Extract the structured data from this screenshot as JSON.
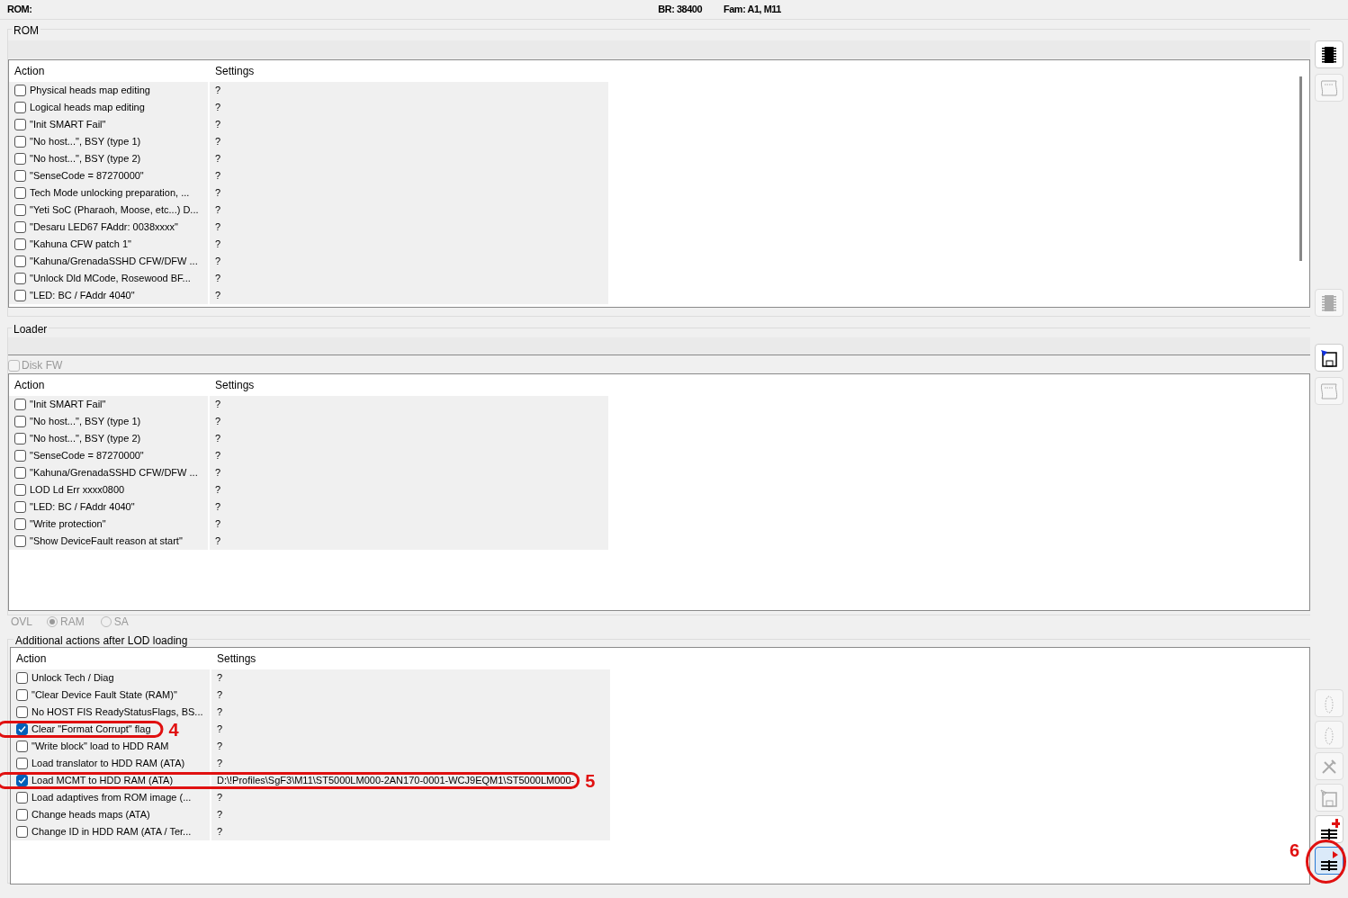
{
  "status_bar": {
    "left": "ROM:",
    "baud": "BR: 38400",
    "family": "Fam: A1, M11"
  },
  "rom": {
    "title": "ROM",
    "columns": [
      "Action",
      "Settings"
    ],
    "rows": [
      {
        "action": "Physical heads map editing",
        "settings": "?",
        "checked": false
      },
      {
        "action": "Logical heads map editing",
        "settings": "?",
        "checked": false
      },
      {
        "action": "\"Init SMART Fail\"",
        "settings": "?",
        "checked": false
      },
      {
        "action": "\"No host...\", BSY (type 1)",
        "settings": "?",
        "checked": false
      },
      {
        "action": "\"No host...\", BSY (type 2)",
        "settings": "?",
        "checked": false
      },
      {
        "action": "\"SenseCode = 87270000\"",
        "settings": "?",
        "checked": false
      },
      {
        "action": "Tech Mode unlocking preparation, ...",
        "settings": "?",
        "checked": false
      },
      {
        "action": "\"Yeti SoC (Pharaoh, Moose, etc...) D...",
        "settings": "?",
        "checked": false
      },
      {
        "action": "\"Desaru LED67 FAddr: 0038xxxx\"",
        "settings": "?",
        "checked": false
      },
      {
        "action": "\"Kahuna CFW patch 1\"",
        "settings": "?",
        "checked": false
      },
      {
        "action": "\"Kahuna/GrenadaSSHD CFW/DFW ...",
        "settings": "?",
        "checked": false
      },
      {
        "action": "\"Unlock Dld MCode, Rosewood BF...",
        "settings": "?",
        "checked": false
      },
      {
        "action": "\"LED: BC / FAddr 4040\"",
        "settings": "?",
        "checked": false
      }
    ],
    "tools": [
      {
        "kind": "chip",
        "disabled": false
      },
      {
        "kind": "tape",
        "disabled": true
      }
    ],
    "bottom_tools": [
      {
        "kind": "chip",
        "disabled": true
      }
    ]
  },
  "loader": {
    "title": "Loader",
    "disk_fw": {
      "label": "Disk FW",
      "checked": false,
      "disabled": true
    },
    "columns": [
      "Action",
      "Settings"
    ],
    "rows": [
      {
        "action": "\"Init SMART Fail\"",
        "settings": "?",
        "checked": false
      },
      {
        "action": "\"No host...\", BSY (type 1)",
        "settings": "?",
        "checked": false
      },
      {
        "action": "\"No host...\", BSY (type 2)",
        "settings": "?",
        "checked": false
      },
      {
        "action": "\"SenseCode = 87270000\"",
        "settings": "?",
        "checked": false
      },
      {
        "action": "\"Kahuna/GrenadaSSHD CFW/DFW ...",
        "settings": "?",
        "checked": false
      },
      {
        "action": "LOD Ld Err xxxx0800",
        "settings": "?",
        "checked": false
      },
      {
        "action": "\"LED: BC / FAddr 4040\"",
        "settings": "?",
        "checked": false
      },
      {
        "action": "\"Write protection\"",
        "settings": "?",
        "checked": false
      },
      {
        "action": "\"Show DeviceFault reason at start\"",
        "settings": "?",
        "checked": false
      }
    ],
    "tools": [
      {
        "kind": "floppy",
        "disabled": false
      },
      {
        "kind": "tape",
        "disabled": true
      }
    ]
  },
  "ovl": {
    "label": "OVL",
    "options": [
      {
        "label": "RAM",
        "selected": true
      },
      {
        "label": "SA",
        "selected": false
      }
    ]
  },
  "additional": {
    "title": "Additional actions after LOD loading",
    "columns": [
      "Action",
      "Settings"
    ],
    "rows": [
      {
        "action": "Unlock Tech / Diag",
        "settings": "?",
        "checked": false
      },
      {
        "action": "\"Clear Device Fault State (RAM)\"",
        "settings": "?",
        "checked": false
      },
      {
        "action": "No HOST FIS ReadyStatusFlags, BS...",
        "settings": "?",
        "checked": false
      },
      {
        "action": "Clear \"Format Corrupt\" flag",
        "settings": "?",
        "checked": true
      },
      {
        "action": "\"Write block\" load to HDD RAM",
        "settings": "?",
        "checked": false
      },
      {
        "action": "Load translator to HDD RAM (ATA)",
        "settings": "?",
        "checked": false
      },
      {
        "action": "Load MCMT to HDD RAM (ATA)",
        "settings": "D:\\!Profiles\\SgF3\\M11\\ST5000LM000-2AN170-0001-WCJ9EQM1\\ST5000LM000-",
        "checked": true
      },
      {
        "action": "Load adaptives from ROM image (...",
        "settings": "?",
        "checked": false
      },
      {
        "action": "Change heads maps (ATA)",
        "settings": "?",
        "checked": false
      },
      {
        "action": "Change ID in HDD RAM (ATA / Ter...",
        "settings": "?",
        "checked": false
      }
    ],
    "tools": [
      {
        "kind": "head",
        "disabled": true,
        "selected": false
      },
      {
        "kind": "head",
        "disabled": true,
        "selected": false
      },
      {
        "kind": "tools",
        "disabled": true,
        "selected": false
      },
      {
        "kind": "floppy",
        "disabled": true,
        "selected": false
      },
      {
        "kind": "add",
        "disabled": false,
        "selected": false
      },
      {
        "kind": "run",
        "disabled": false,
        "selected": true
      }
    ]
  },
  "annotations": [
    {
      "label": "4"
    },
    {
      "label": "5"
    },
    {
      "label": "6"
    }
  ]
}
